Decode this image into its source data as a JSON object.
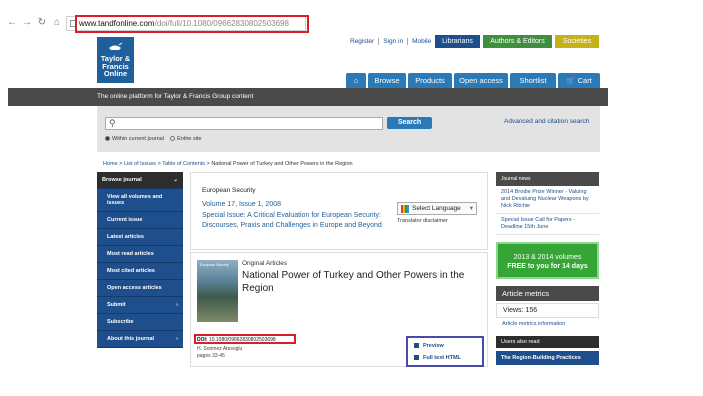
{
  "browser": {
    "url_host": "www.tandfonline.com",
    "url_path": "/doi/full/10.1080/09662830802503698"
  },
  "site": {
    "logo_line1": "Taylor &",
    "logo_line2": "Francis",
    "logo_line3": "Online",
    "top_links": [
      "Register",
      "Sign in",
      "Mobile"
    ],
    "pills": [
      {
        "label": "Librarians",
        "color": "#1f4e8c"
      },
      {
        "label": "Authors & Editors",
        "color": "#3f8f3f"
      },
      {
        "label": "Societies",
        "color": "#c4b21a"
      }
    ],
    "nav": [
      "Browse",
      "Products",
      "Open access",
      "Shortlist",
      "Cart"
    ],
    "banner": "The online platform for Taylor & Francis Group content"
  },
  "search": {
    "button": "Search",
    "advanced": "Advanced and citation search",
    "option_within": "Within current journal",
    "option_entire": "Entire site"
  },
  "breadcrumb": {
    "home": "Home",
    "issues": "List of Issues",
    "toc": "Table of Contents",
    "current": "National Power of Turkey and Other Powers in the Region"
  },
  "sidebar": {
    "items": [
      "Browse journal",
      "View all volumes and issues",
      "Current issue",
      "Latest articles",
      "Most read articles",
      "Most cited articles",
      "Open access articles",
      "Submit",
      "Subscribe",
      "About this journal"
    ]
  },
  "journal": {
    "name": "European Security",
    "volume": "Volume 17, Issue 1, 2008",
    "special_issue": "Special Issue:   A Critical Evaluation for European Security: Discourses, Praxis and Challenges in Europe and Beyond",
    "language": "Select Language",
    "translator": "Translator disclaimer"
  },
  "article": {
    "cover_title": "European Security",
    "type": "Original Articles",
    "title": "National Power of Turkey and Other Powers in the Region",
    "doi_label": "DOI:",
    "doi": "10.1080/09662830802503698",
    "author": "H. Sonmez Atesoglu",
    "pages": "pages 33-45",
    "access": [
      "Preview",
      "Full text HTML"
    ]
  },
  "right": {
    "news_head": "Journal news",
    "news": [
      "2014 Brodie Prize Winner - Valuing and Devaluing Nuclear Weapons by Nick Ritchie",
      "Special Issue Call for Papers - Deadline 15th June"
    ],
    "promo_line1": "2013 & 2014 volumes",
    "promo_line2": "FREE to you for 14 days",
    "metrics_head": "Article metrics",
    "views": "Views: 156",
    "metrics_info": "Article metrics information",
    "users_head": "Users also read",
    "users_item": "The Region-Building Practices"
  }
}
